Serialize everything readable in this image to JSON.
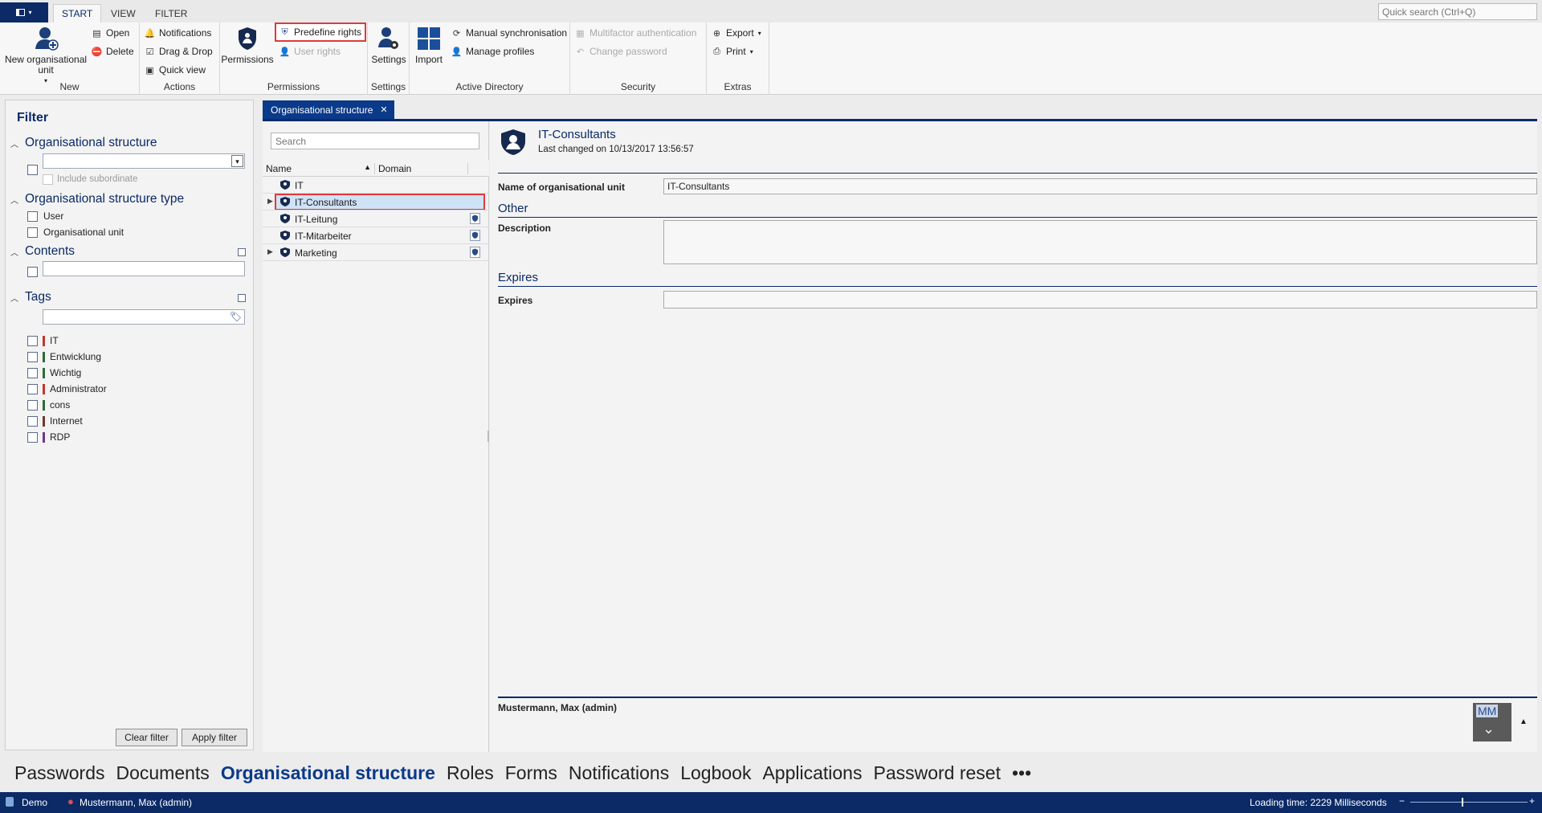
{
  "ribbon_tabs": [
    "START",
    "VIEW",
    "FILTER"
  ],
  "quick_search": {
    "placeholder": "Quick search (Ctrl+Q)"
  },
  "ribbon": {
    "new_ou": "New organisational unit",
    "group_new": "New",
    "open": "Open",
    "delete": "Delete",
    "notifications": "Notifications",
    "drag_drop": "Drag & Drop",
    "quick_view": "Quick view",
    "group_actions": "Actions",
    "permissions": "Permissions",
    "predefine_rights": "Predefine rights",
    "user_rights": "User rights",
    "group_permissions": "Permissions",
    "settings": "Settings",
    "group_settings": "Settings",
    "import": "Import",
    "manual_sync": "Manual synchronisation",
    "manage_profiles": "Manage profiles",
    "group_ad": "Active Directory",
    "mfa": "Multifactor authentication",
    "change_password": "Change password",
    "group_security": "Security",
    "export": "Export",
    "print": "Print",
    "group_extras": "Extras"
  },
  "filter": {
    "title": "Filter",
    "org_structure": "Organisational structure",
    "include_subordinate": "Include subordinate",
    "org_type": "Organisational structure type",
    "type_user": "User",
    "type_ou": "Organisational unit",
    "contents": "Contents",
    "tags_title": "Tags",
    "tags": [
      {
        "label": "IT",
        "color": "#c0392b"
      },
      {
        "label": "Entwicklung",
        "color": "#2e6b3a"
      },
      {
        "label": "Wichtig",
        "color": "#2e6b3a"
      },
      {
        "label": "Administrator",
        "color": "#c0392b"
      },
      {
        "label": "cons",
        "color": "#2e6b3a"
      },
      {
        "label": "Internet",
        "color": "#6b3a2e"
      },
      {
        "label": "RDP",
        "color": "#6a3a8a"
      }
    ],
    "clear": "Clear filter",
    "apply": "Apply filter"
  },
  "doc_tab": "Organisational structure",
  "list": {
    "search_placeholder": "Search",
    "col_name": "Name",
    "col_domain": "Domain",
    "rows": [
      "IT",
      "IT-Consultants",
      "IT-Leitung",
      "IT-Mitarbeiter",
      "Marketing"
    ]
  },
  "detail": {
    "title": "IT-Consultants",
    "changed": "Last changed on 10/13/2017 13:56:57",
    "name_label": "Name of organisational unit",
    "name_value": "IT-Consultants",
    "other": "Other",
    "description": "Description",
    "expires_section": "Expires",
    "expires_label": "Expires",
    "footer_user": "Mustermann, Max (admin)",
    "avatar": "MM"
  },
  "bottom_nav": [
    "Passwords",
    "Documents",
    "Organisational structure",
    "Roles",
    "Forms",
    "Notifications",
    "Logbook",
    "Applications",
    "Password reset",
    "•••"
  ],
  "status": {
    "db": "Demo",
    "user": "Mustermann, Max (admin)",
    "loading": "Loading time: 2229 Milliseconds"
  },
  "colors": {
    "accent": "#0b2a66",
    "selection_outline": "#e0393b"
  }
}
